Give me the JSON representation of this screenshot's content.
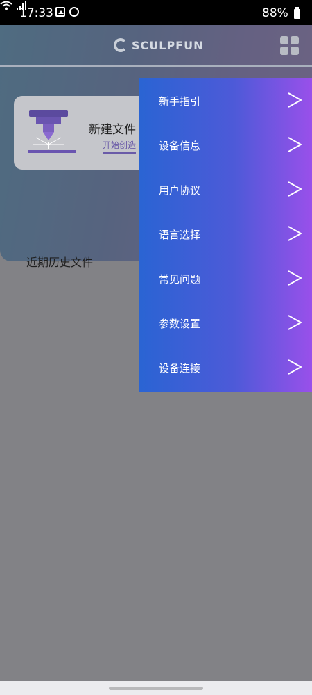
{
  "status_bar": {
    "time": "17:33",
    "battery": "88%",
    "icons": [
      "image-icon",
      "vpn-icon",
      "wifi-icon",
      "signal-icon",
      "battery-icon"
    ]
  },
  "header": {
    "logo_text": "SCULPFUN",
    "menu_icon": "grid-icon"
  },
  "new_file_card": {
    "title": "新建文件",
    "subtitle": "开始创造"
  },
  "recent": {
    "label": "近期历史文件"
  },
  "drawer": {
    "items": [
      {
        "label": "新手指引"
      },
      {
        "label": "设备信息"
      },
      {
        "label": "用户协议"
      },
      {
        "label": "语言选择"
      },
      {
        "label": "常见问题"
      },
      {
        "label": "参数设置"
      },
      {
        "label": "设备连接"
      }
    ]
  },
  "colors": {
    "drawer_start": "#2a64d3",
    "drawer_end": "#9950ea",
    "status_bar": "#000000"
  }
}
